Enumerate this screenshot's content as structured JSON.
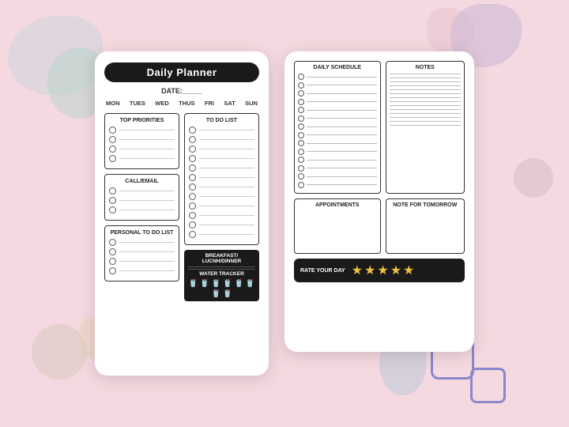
{
  "background": {
    "color": "#f5d9e0"
  },
  "left_page": {
    "title": "Daily Planner",
    "date_label": "DATE:_____",
    "days": [
      "MON",
      "TUES",
      "WED",
      "THUS",
      "FRI",
      "SAT",
      "SUN"
    ],
    "top_priorities": {
      "title": "TOP PRIORITIES",
      "rows": 4
    },
    "call_email": {
      "title": "CALL/EMAIL",
      "rows": 3
    },
    "personal_todo": {
      "title": "PERSONAL TO DO LIST",
      "rows": 4
    },
    "todo_list": {
      "title": "TO DO LIST",
      "rows": 12
    },
    "meal": {
      "title": "BREAKFAST/ LUCNH/DINNER",
      "lines": 2
    },
    "water_tracker": {
      "label": "WATER TRACKER",
      "cups": 8,
      "cup_icon": "🥤"
    }
  },
  "right_page": {
    "schedule": {
      "title": "DAILY SCHEDULE",
      "rows": 14
    },
    "notes": {
      "title": "NOTES",
      "rows": 14
    },
    "appointments": {
      "title": "APPOINTMENTS"
    },
    "note_tomorrow": {
      "title": "NOTE FOR TOMORROW"
    },
    "rate_day": {
      "label": "RATE YOUR DAY",
      "stars": "★★★★★"
    }
  }
}
